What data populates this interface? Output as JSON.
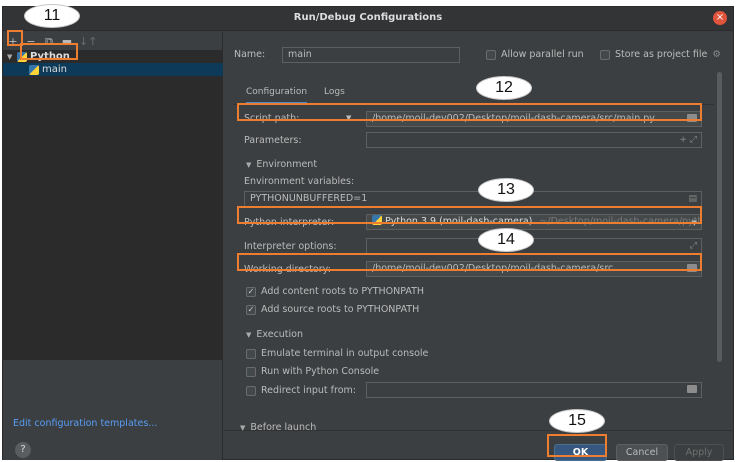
{
  "window": {
    "title": "Run/Debug Configurations"
  },
  "toolbar": {
    "add": "+",
    "remove": "−",
    "copy": "⧉",
    "folder": "▬",
    "sort": "↓↑"
  },
  "tree": {
    "group_label": "Python",
    "item_label": "main"
  },
  "left_footer": {
    "edit_templates": "Edit configuration templates...",
    "help": "?"
  },
  "form": {
    "name_label": "Name:",
    "name_value": "main",
    "allow_parallel": "Allow parallel run",
    "store_as_project": "Store as project file",
    "tabs": [
      "Configuration",
      "Logs"
    ],
    "script_path_label": "Script path:",
    "script_path_value": "/home/moil-dev002/Desktop/moil-dash-camera/src/main.py",
    "parameters_label": "Parameters:",
    "environment_section": "Environment",
    "env_vars_label": "Environment variables:",
    "env_vars_value": "PYTHONUNBUFFERED=1",
    "interpreter_label": "Python interpreter:",
    "interpreter_value": "Python 3.9 (moil-dash-camera)",
    "interpreter_path": "~/Desktop/moil-dash-camera/python/bi",
    "interpreter_options_label": "Interpreter options:",
    "working_dir_label": "Working directory:",
    "working_dir_value": "/home/moil-dev002/Desktop/moil-dash-camera/src",
    "add_content_roots": "Add content roots to PYTHONPATH",
    "add_source_roots": "Add source roots to PYTHONPATH",
    "execution_section": "Execution",
    "emulate_terminal": "Emulate terminal in output console",
    "run_with_console": "Run with Python Console",
    "redirect_input": "Redirect input from:",
    "before_launch": "Before launch"
  },
  "buttons": {
    "ok": "OK",
    "cancel": "Cancel",
    "apply": "Apply"
  },
  "callouts": {
    "c11": "11",
    "c12": "12",
    "c13": "13",
    "c14": "14",
    "c15": "15"
  },
  "colors": {
    "highlight": "#ed7d31",
    "accent": "#4a88c7",
    "link": "#589df6"
  }
}
